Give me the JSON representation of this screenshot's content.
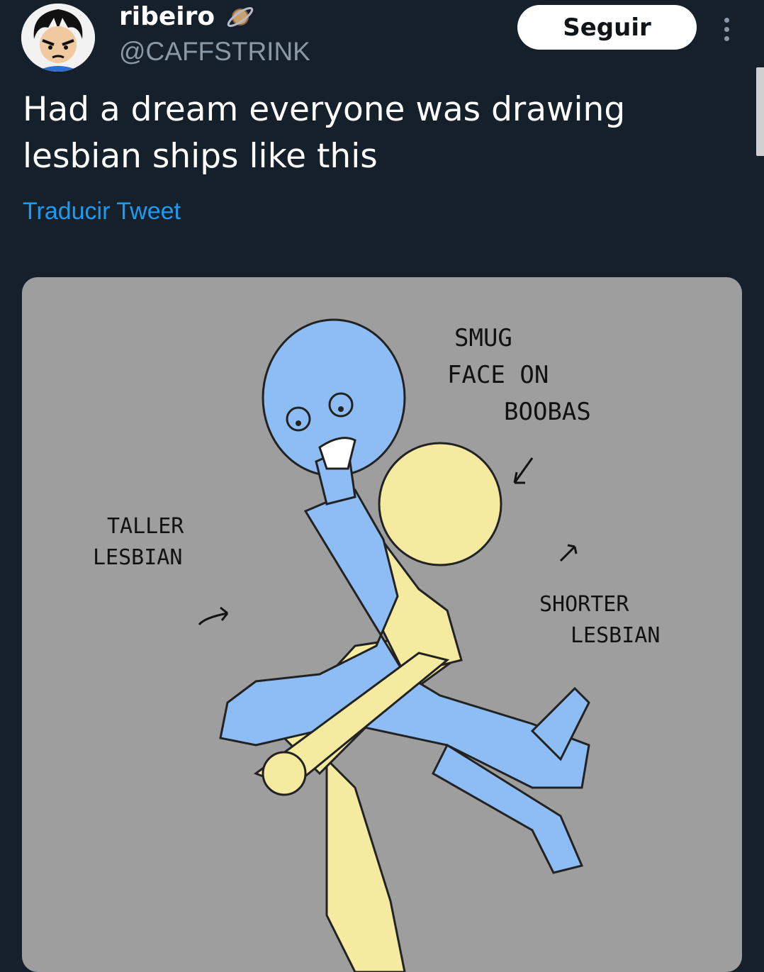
{
  "author": {
    "display_name": "ribeiro",
    "handle": "@CAFFSTRINK",
    "avatar_icon": "anime-character-avatar",
    "badge_icon": "planet-emoji-icon"
  },
  "actions": {
    "follow_label": "Seguir",
    "more_icon": "vertical-ellipsis-icon"
  },
  "tweet": {
    "text": "Had a dream everyone was drawing lesbian ships like this",
    "translate_label": "Traducir Tweet"
  },
  "media": {
    "annotations": {
      "smug": [
        "SMUG",
        "FACE ON",
        "BOOBAS"
      ],
      "taller": [
        "TALLER",
        "LESBIAN"
      ],
      "shorter": [
        "SHORTER",
        "LESBIAN"
      ]
    }
  },
  "colors": {
    "background": "#15202b",
    "accent": "#1d9bf0",
    "secondary_text": "#8b98a5",
    "media_bg": "#9e9e9e",
    "blue_figure": "#8ebdf5",
    "yellow_figure": "#f5eba0"
  }
}
